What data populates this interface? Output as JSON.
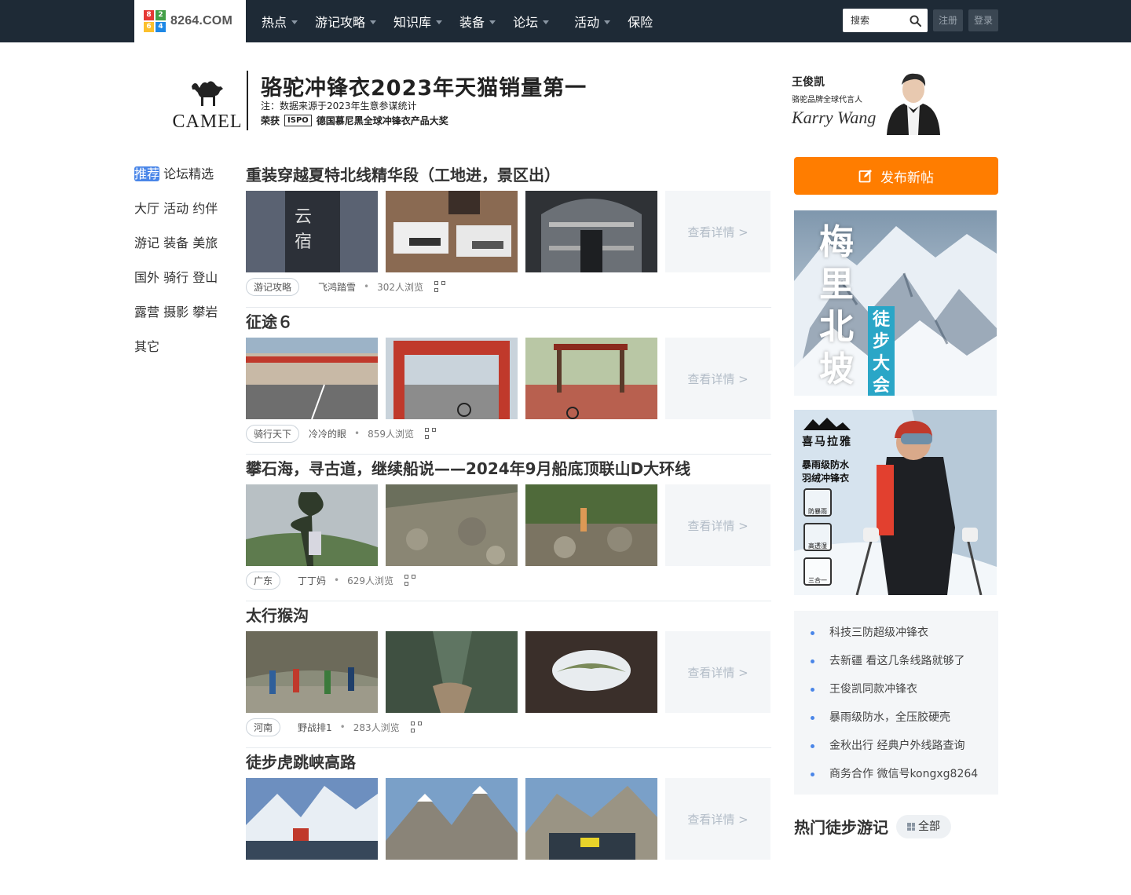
{
  "header": {
    "logo_text": "8264.COM",
    "logo_digits": [
      "8",
      "2",
      "6",
      "4"
    ],
    "nav": [
      {
        "label": "热点",
        "dropdown": true
      },
      {
        "label": "游记攻略",
        "dropdown": true
      },
      {
        "label": "知识库",
        "dropdown": true
      },
      {
        "label": "装备",
        "dropdown": true
      },
      {
        "label": "论坛",
        "dropdown": true
      },
      {
        "label": "活动",
        "dropdown": true
      },
      {
        "label": "保险",
        "dropdown": false
      }
    ],
    "search_placeholder": "搜索",
    "register": "注册",
    "login": "登录"
  },
  "banner": {
    "brand": "CAMEL",
    "title": "骆驼冲锋衣2023年天猫销量第一",
    "note": "注：数据来源于2023年生意参谋统计",
    "award_prefix": "荣获",
    "award_badge": "ISPO",
    "award_text": "德国慕尼黑全球冲锋衣产品大奖",
    "spokes_name": "王俊凯",
    "spokes_role": "骆驼品牌全球代言人",
    "signature": "Karry Wang"
  },
  "categories": [
    "推荐",
    "论坛精选",
    "大厅",
    "活动",
    "约伴",
    "游记",
    "装备",
    "美旅",
    "国外",
    "骑行",
    "登山",
    "露营",
    "摄影",
    "攀岩",
    "其它"
  ],
  "active_category": "推荐",
  "more_label": "查看详情 >",
  "posts": [
    {
      "title": "重装穿越夏特北线精华段（工地进，景区出）",
      "tag": "游记攻略",
      "author": "飞鸿踏雪",
      "views": "302人浏览",
      "palette": "night"
    },
    {
      "title": "征途６",
      "tag": "骑行天下",
      "author": "冷冷的眼",
      "views": "859人浏览",
      "palette": "town"
    },
    {
      "title": "攀石海，寻古道，继续船说——2024年9月船底顶联山D大环线",
      "tag": "广东",
      "author": "丁丁妈",
      "views": "629人浏览",
      "palette": "forest"
    },
    {
      "title": "太行猴沟",
      "tag": "河南",
      "author": "野战排1",
      "views": "283人浏览",
      "palette": "canyon"
    },
    {
      "title": "徒步虎跳峡高路",
      "tag": "",
      "author": "",
      "views": "",
      "palette": "snow"
    }
  ],
  "sidebar": {
    "publish_label": "发布新帖",
    "ad1_text": [
      "梅",
      "里",
      "北",
      "坡"
    ],
    "ad1_sub": [
      "徒",
      "步",
      "大",
      "会"
    ],
    "ad2_brand": "喜马拉雅",
    "ad2_lines": [
      "暴雨级防水",
      "羽绒冲锋衣"
    ],
    "ad2_badges": [
      "防暴雨",
      "高透湿",
      "三合一"
    ],
    "links": [
      "科技三防超级冲锋衣",
      "去新疆 看这几条线路就够了",
      "王俊凯同款冲锋衣",
      "暴雨级防水，全压胶硬壳",
      "金秋出行 经典户外线路查询",
      "商务合作 微信号kongxg8264"
    ],
    "hot_title": "热门徒步游记",
    "hot_all": "全部"
  },
  "colors": {
    "topbar": "#1e2a36",
    "accent_blue": "#4a86e8",
    "publish_orange": "#ff7d00"
  }
}
